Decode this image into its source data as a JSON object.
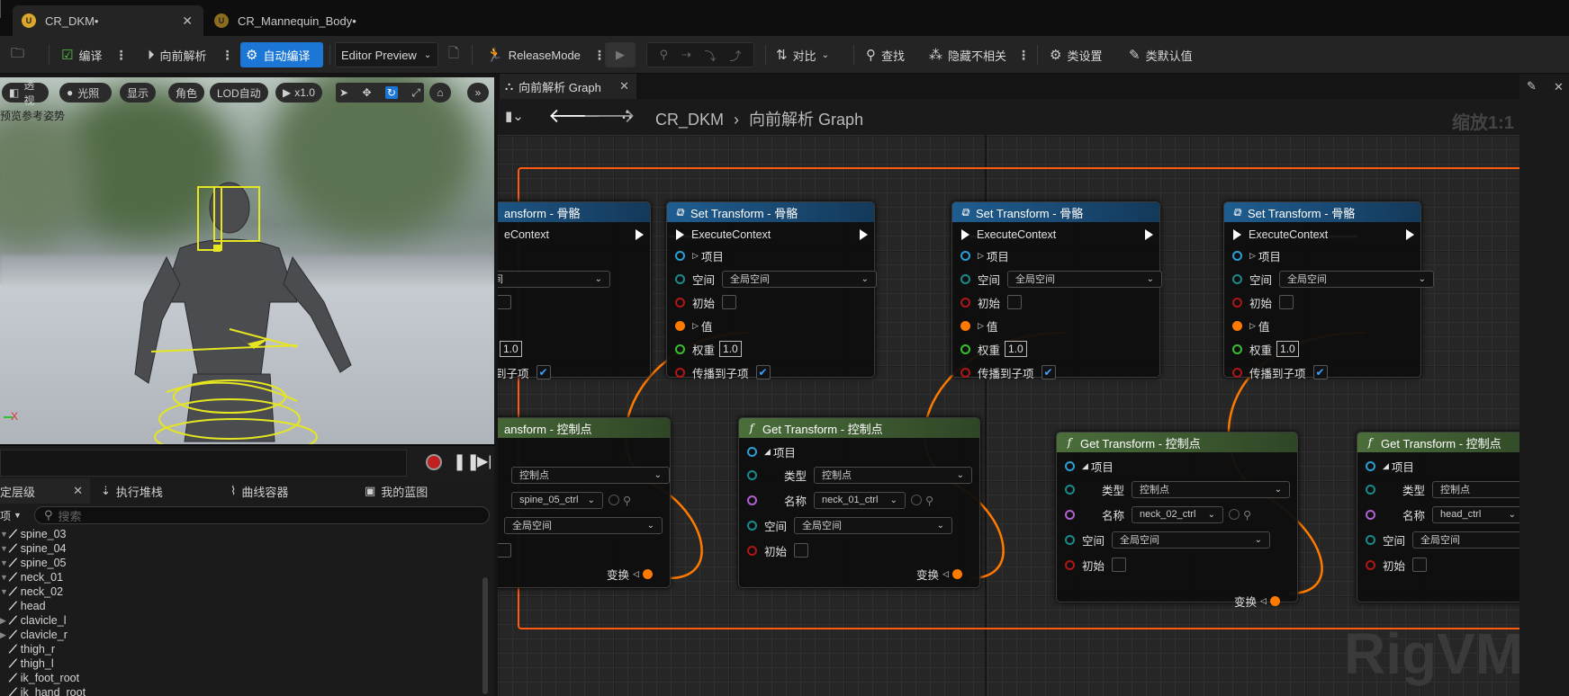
{
  "tabs": [
    {
      "label": "CR_DKM•",
      "active": true
    },
    {
      "label": "CR_Mannequin_Body•",
      "active": false
    }
  ],
  "toolbar": {
    "compile": "编译",
    "forward_solve": "向前解析",
    "auto_compile": "自动编译",
    "preview": "Editor Preview",
    "release_mode": "ReleaseMode",
    "diff": "对比",
    "find": "查找",
    "hide_unrelated": "隐藏不相关",
    "class_settings": "类设置",
    "class_defaults": "类默认值"
  },
  "viewport": {
    "perspective": "透视",
    "lit": "光照",
    "show": "显示",
    "character": "角色",
    "lod": "LOD自动",
    "speed": "x1.0",
    "ref_pose_label": "预览参考姿势",
    "axis_x": "X",
    "accent": "#e5e520"
  },
  "left_panel": {
    "tabs": [
      "定层级",
      "执行堆栈",
      "曲线容器",
      "我的蓝图"
    ],
    "search_placeholder": "搜索",
    "filter_label": "项",
    "tree": [
      {
        "label": "spine_03",
        "indent": 4
      },
      {
        "label": "spine_04",
        "indent": 2
      },
      {
        "label": "spine_05",
        "indent": 3
      },
      {
        "label": "neck_01",
        "indent": 4
      },
      {
        "label": "neck_02",
        "indent": 5
      },
      {
        "label": "head",
        "indent": 6
      },
      {
        "label": "clavicle_l",
        "indent": 4
      },
      {
        "label": "clavicle_r",
        "indent": 4
      },
      {
        "label": "thigh_r",
        "indent": 0
      },
      {
        "label": "thigh_l",
        "indent": 0
      },
      {
        "label": "ik_foot_root",
        "indent": 0
      },
      {
        "label": "ik_hand_root",
        "indent": 0
      }
    ]
  },
  "graph": {
    "tab_label": "向前解析 Graph",
    "breadcrumb_root": "CR_DKM",
    "breadcrumb_leaf": "向前解析 Graph",
    "zoom": "缩放1:1",
    "watermark": "RigVM",
    "accent": "#ff7a00"
  },
  "node_text": {
    "set_title": "Set Transform - 骨骼",
    "set_title_cut": "ansform - 骨骼",
    "get_title": "Get Transform - 控制点",
    "get_title_cut": "ansform - 控制点",
    "execute": "ExecuteContext",
    "execute_cut": "eContext",
    "item": "项目",
    "space": "空间",
    "global_space": "全局空间",
    "initial": "初始",
    "value": "值",
    "weight": "权重",
    "weight_value": "1.0",
    "propagate": "传播到子项",
    "propagate_cut": "到子项",
    "type": "类型",
    "control": "控制点",
    "name": "名称",
    "transform": "变换"
  },
  "get_nodes": [
    {
      "name_value": "spine_05_ctrl"
    },
    {
      "name_value": "neck_01_ctrl"
    },
    {
      "name_value": "neck_02_ctrl"
    },
    {
      "name_value": "head_ctrl"
    }
  ]
}
